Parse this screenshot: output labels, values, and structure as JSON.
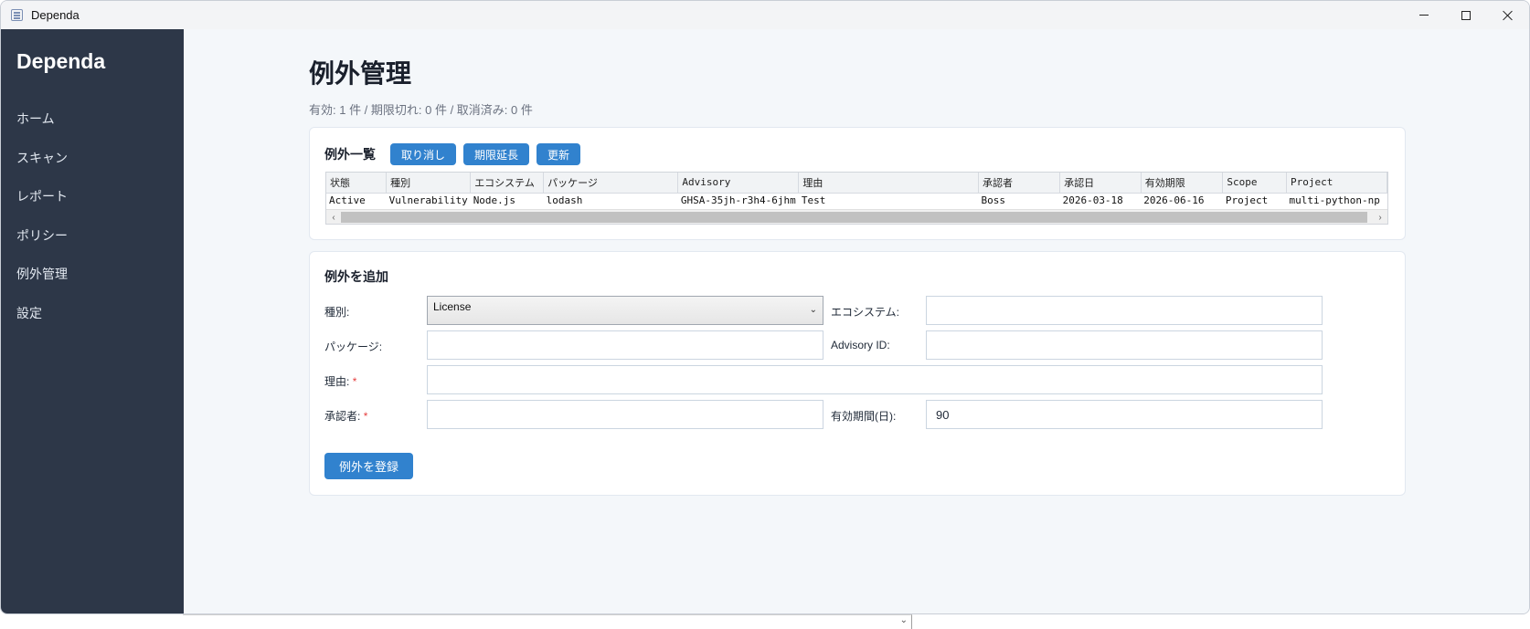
{
  "window": {
    "title": "Dependa"
  },
  "sidebar": {
    "brand": "Dependa",
    "items": [
      {
        "label": "ホーム"
      },
      {
        "label": "スキャン"
      },
      {
        "label": "レポート"
      },
      {
        "label": "ポリシー"
      },
      {
        "label": "例外管理"
      },
      {
        "label": "設定"
      }
    ]
  },
  "page": {
    "title": "例外管理",
    "summary": "有効: 1 件 / 期限切れ: 0 件 / 取消済み: 0 件"
  },
  "list_card": {
    "title": "例外一覧",
    "buttons": {
      "revoke": "取り消し",
      "extend": "期限延長",
      "refresh": "更新"
    },
    "columns": [
      "状態",
      "種別",
      "エコシステム",
      "パッケージ",
      "Advisory",
      "理由",
      "承認者",
      "承認日",
      "有効期限",
      "Scope",
      "Project"
    ],
    "rows": [
      [
        "Active",
        "Vulnerability",
        "Node.js",
        "lodash",
        "GHSA-35jh-r3h4-6jhm",
        "Test",
        "Boss",
        "2026-03-18",
        "2026-06-16",
        "Project",
        "multi-python-np"
      ]
    ]
  },
  "add_card": {
    "title": "例外を追加",
    "type_label": "種別:",
    "type_value": "License",
    "ecosystem_label": "エコシステム:",
    "ecosystem_value": "",
    "package_label": "パッケージ:",
    "package_value": "",
    "advisory_label": "Advisory ID:",
    "advisory_value": "",
    "reason_label": "理由:",
    "reason_value": "",
    "approver_label": "承認者:",
    "approver_value": "",
    "required_mark": "*",
    "validity_label": "有効期間(日):",
    "validity_value": "90",
    "submit": "例外を登録"
  },
  "colors": {
    "sidebar_bg": "#2d3748",
    "accent": "#3182ce",
    "main_bg": "#f4f7fa",
    "required": "#e53e3e"
  },
  "icons": [
    "app-icon",
    "minimize-icon",
    "maximize-icon",
    "close-icon",
    "chevron-down-icon",
    "scroll-left-icon",
    "scroll-right-icon"
  ]
}
